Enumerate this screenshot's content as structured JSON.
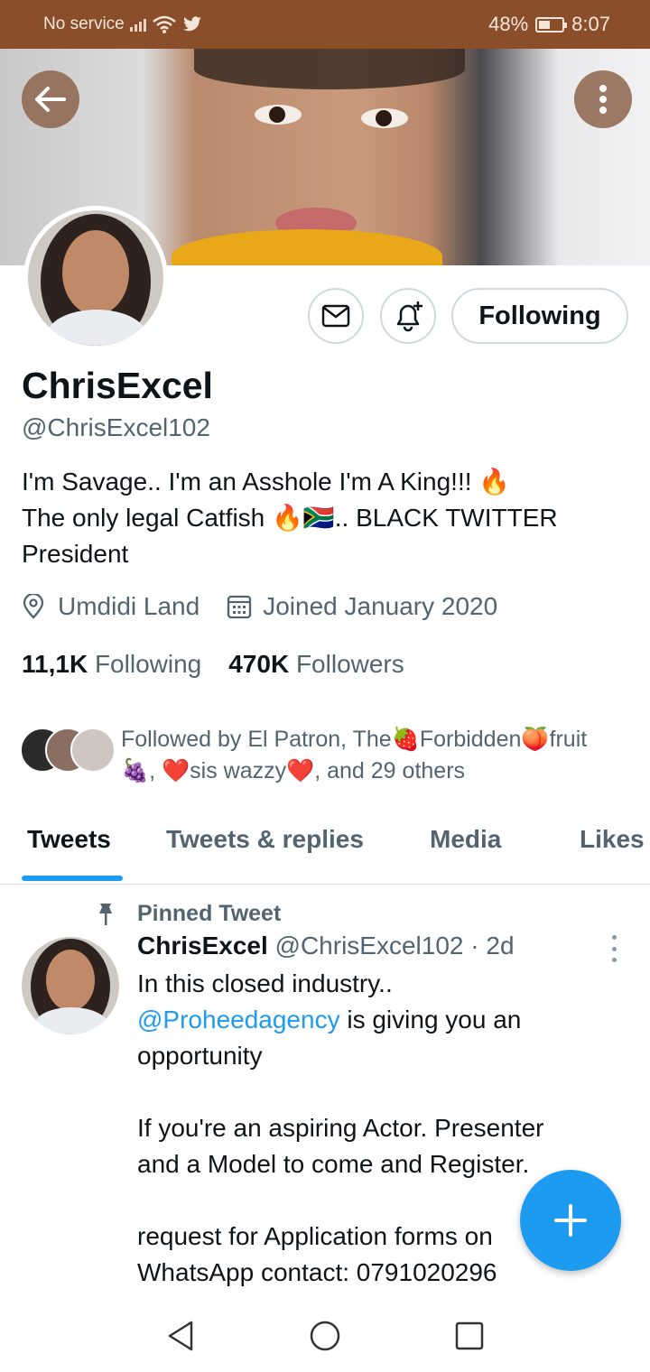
{
  "status_bar": {
    "carrier": "No service",
    "battery": "48%",
    "battery_level": 0.48,
    "time": "8:07",
    "icons": [
      "signal-icon",
      "wifi-icon",
      "twitter-bird-icon",
      "battery-icon"
    ]
  },
  "header": {
    "back_icon": "arrow-left-icon",
    "more_icon": "kebab-vertical-icon"
  },
  "actions": {
    "message_icon": "envelope-icon",
    "notify_icon": "bell-plus-icon",
    "follow_label": "Following"
  },
  "profile": {
    "name": "ChrisExcel",
    "handle": "@ChrisExcel102",
    "bio": {
      "line1": "I'm Savage.. I'm an Asshole I'm A King!!! 🔥",
      "line2": "The only legal Catfish 🔥🇿🇦.. BLACK TWITTER",
      "line3": "President"
    },
    "location": "Umdidi Land",
    "joined": "Joined January 2020",
    "following_count": "11,1K",
    "following_label": "Following",
    "followers_count": "470K",
    "followers_label": "Followers"
  },
  "followed_by": {
    "line1": "Followed by El Patron, The🍓Forbidden🍑fruit",
    "line2": "🍇, ❤️sis wazzy❤️, and 29 others"
  },
  "tabs": [
    {
      "label": "Tweets",
      "active": true
    },
    {
      "label": "Tweets & replies",
      "active": false
    },
    {
      "label": "Media",
      "active": false
    },
    {
      "label": "Likes",
      "active": false
    }
  ],
  "pinned_tweet": {
    "pinned_label": "Pinned Tweet",
    "author_name": "ChrisExcel",
    "author_handle": "@ChrisExcel102",
    "time_ago": "· 2d",
    "text_line1": "In this closed industry..",
    "mention": "@Proheedagency",
    "text_line2_rest": " is giving you an",
    "text_line3": "opportunity",
    "text_line4": "If you're an aspiring Actor. Presenter",
    "text_line5": "and a Model to come and Register.",
    "text_line6": "request for Application forms on",
    "text_line7": "WhatsApp contact: 0791020296"
  },
  "fab": {
    "icon": "plus-icon"
  },
  "nav": {
    "icons": [
      "nav-back-icon",
      "nav-home-icon",
      "nav-recents-icon"
    ]
  },
  "colors": {
    "status_bar": "#8a4f2a",
    "accent": "#1d9bf0",
    "text_primary": "#0f1419",
    "text_secondary": "#536471",
    "border": "#cfd9de"
  }
}
